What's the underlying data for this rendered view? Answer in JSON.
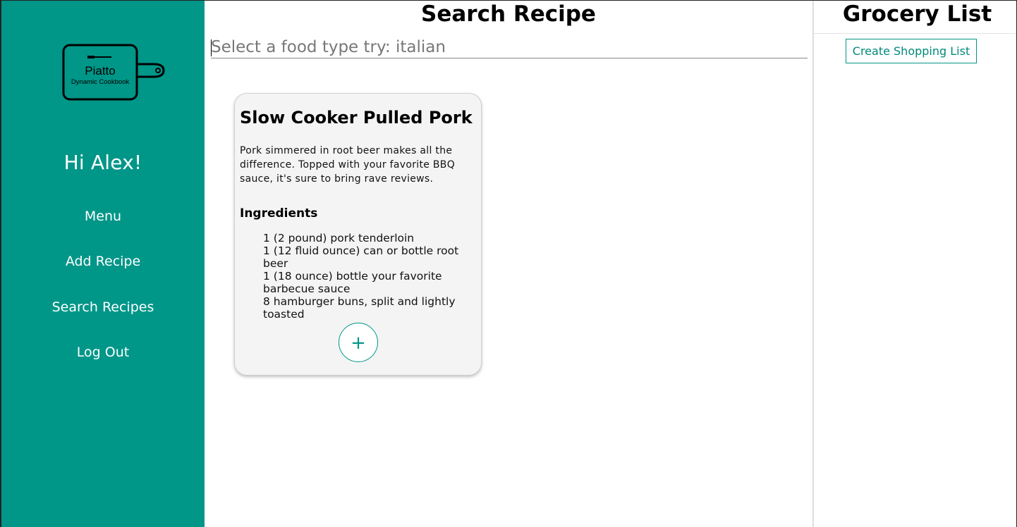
{
  "sidebar": {
    "logo": {
      "title": "Piatto",
      "subtitle": "Dynamic Cookbook"
    },
    "greeting": "Hi Alex!",
    "nav": [
      {
        "label": "Menu"
      },
      {
        "label": "Add Recipe"
      },
      {
        "label": "Search Recipes"
      },
      {
        "label": "Log Out"
      }
    ],
    "background_color": "#009688"
  },
  "main": {
    "title": "Search Recipe",
    "search": {
      "placeholder": "Select a food type try: italian",
      "value": ""
    },
    "recipe_card": {
      "title": "Slow Cooker Pulled Pork",
      "description": "Pork simmered in root beer makes all the difference. Topped with your favorite BBQ sauce, it's sure to bring rave reviews.",
      "ingredients_heading": "Ingredients",
      "ingredients": [
        "1 (2 pound) pork tenderloin",
        "1 (12 fluid ounce) can or bottle root beer",
        "1 (18 ounce) bottle your favorite barbecue sauce",
        "8 hamburger buns, split and lightly toasted"
      ],
      "add_button_label": "+"
    }
  },
  "grocery": {
    "title": "Grocery List",
    "create_button_label": "Create Shopping List",
    "accent_color": "#009688"
  }
}
